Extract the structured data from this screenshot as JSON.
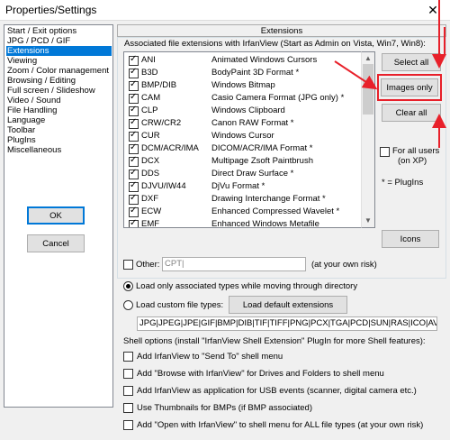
{
  "window": {
    "title": "Properties/Settings",
    "close_glyph": "✕"
  },
  "sidebar": {
    "items": [
      {
        "label": "Start / Exit options",
        "selected": false
      },
      {
        "label": "JPG / PCD / GIF",
        "selected": false
      },
      {
        "label": "Extensions",
        "selected": true
      },
      {
        "label": "Viewing",
        "selected": false
      },
      {
        "label": "Zoom / Color management",
        "selected": false
      },
      {
        "label": "Browsing / Editing",
        "selected": false
      },
      {
        "label": "Full screen / Slideshow",
        "selected": false
      },
      {
        "label": "Video / Sound",
        "selected": false
      },
      {
        "label": "File Handling",
        "selected": false
      },
      {
        "label": "Language",
        "selected": false
      },
      {
        "label": "Toolbar",
        "selected": false
      },
      {
        "label": "PlugIns",
        "selected": false
      },
      {
        "label": "Miscellaneous",
        "selected": false
      }
    ],
    "ok_label": "OK",
    "cancel_label": "Cancel"
  },
  "extensions": {
    "tab_title": "Extensions",
    "assoc_heading": "Associated file extensions with IrfanView (Start as Admin on Vista, Win7, Win8):",
    "items": [
      {
        "ext": "ANI",
        "desc": "Animated Windows Cursors",
        "checked": true
      },
      {
        "ext": "B3D",
        "desc": "BodyPaint 3D Format *",
        "checked": true
      },
      {
        "ext": "BMP/DIB",
        "desc": "Windows Bitmap",
        "checked": true
      },
      {
        "ext": "CAM",
        "desc": "Casio Camera Format (JPG only) *",
        "checked": true
      },
      {
        "ext": "CLP",
        "desc": "Windows Clipboard",
        "checked": true
      },
      {
        "ext": "CRW/CR2",
        "desc": "Canon RAW Format *",
        "checked": true
      },
      {
        "ext": "CUR",
        "desc": "Windows Cursor",
        "checked": true
      },
      {
        "ext": "DCM/ACR/IMA",
        "desc": "DICOM/ACR/IMA Format *",
        "checked": true
      },
      {
        "ext": "DCX",
        "desc": "Multipage Zsoft Paintbrush",
        "checked": true
      },
      {
        "ext": "DDS",
        "desc": "Direct Draw Surface *",
        "checked": true
      },
      {
        "ext": "DJVU/IW44",
        "desc": "DjVu Format *",
        "checked": true
      },
      {
        "ext": "DXF",
        "desc": "Drawing Interchange Format *",
        "checked": true
      },
      {
        "ext": "ECW",
        "desc": "Enhanced Compressed Wavelet *",
        "checked": true
      },
      {
        "ext": "EMF",
        "desc": "Enhanced Windows Metafile",
        "checked": true
      }
    ],
    "select_all_label": "Select all",
    "images_only_label": "Images only",
    "clear_all_label": "Clear all",
    "for_all_users_line1": "For all users",
    "for_all_users_line2": "(on XP)",
    "plugins_note": "* = PlugIns",
    "icons_label": "Icons",
    "other_label": "Other:",
    "other_value": "CPT|",
    "other_note": "(at your own risk)",
    "load_only_assoc_label": "Load only associated types while moving through directory",
    "load_custom_label": "Load custom file types:",
    "load_default_label": "Load default extensions",
    "custom_types_value": "JPG|JPEG|JPE|GIF|BMP|DIB|TIF|TIFF|PNG|PCX|TGA|PCD|SUN|RAS|ICO|AVI|IFF|PF"
  },
  "shell": {
    "heading": "Shell options (install \"IrfanView Shell Extension\" PlugIn for more Shell features):",
    "options": [
      {
        "label": "Add IrfanView to \"Send To\" shell menu",
        "checked": false
      },
      {
        "label": "Add \"Browse with IrfanView\" for Drives and Folders to shell menu",
        "checked": false
      },
      {
        "label": "Add IrfanView as application for USB events (scanner, digital camera etc.)",
        "checked": false
      },
      {
        "label": "Use Thumbnails for BMPs (if BMP associated)",
        "checked": false
      },
      {
        "label": "Add \"Open with IrfanView\" to shell menu for ALL file types (at your own risk)",
        "checked": false
      }
    ]
  },
  "colors": {
    "selection": "#0078d7",
    "annotation": "#e8202a",
    "dialog_bg": "#f0f0f0"
  }
}
